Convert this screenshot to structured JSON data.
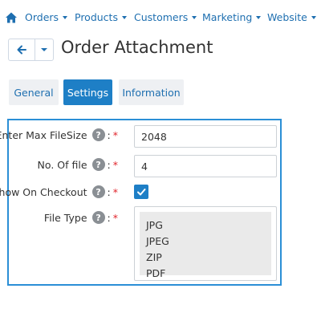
{
  "nav": {
    "items": [
      {
        "label": "Orders"
      },
      {
        "label": "Products"
      },
      {
        "label": "Customers"
      },
      {
        "label": "Marketing"
      },
      {
        "label": "Website"
      }
    ],
    "home_icon": "home-icon"
  },
  "header": {
    "title": "Order Attachment",
    "back_icon": "arrow-left-icon"
  },
  "tabs": [
    {
      "label": "General",
      "active": false
    },
    {
      "label": "Settings",
      "active": true
    },
    {
      "label": "Information",
      "active": false
    }
  ],
  "form": {
    "max_filesize": {
      "label": "Enter Max FileSize",
      "value": "2048"
    },
    "no_of_file": {
      "label": "No. Of file",
      "value": "4"
    },
    "show_on_checkout": {
      "label": "Show On Checkout",
      "checked": true
    },
    "file_type": {
      "label": "File Type",
      "options": [
        "JPG",
        "JPEG",
        "ZIP",
        "PDF"
      ]
    },
    "help_glyph": "?",
    "colon": ":",
    "required_mark": "*"
  },
  "colors": {
    "accent": "#1e7fc6",
    "link": "#1e6fb0",
    "panel_border": "#2b8fd6",
    "required": "#e0242b"
  }
}
